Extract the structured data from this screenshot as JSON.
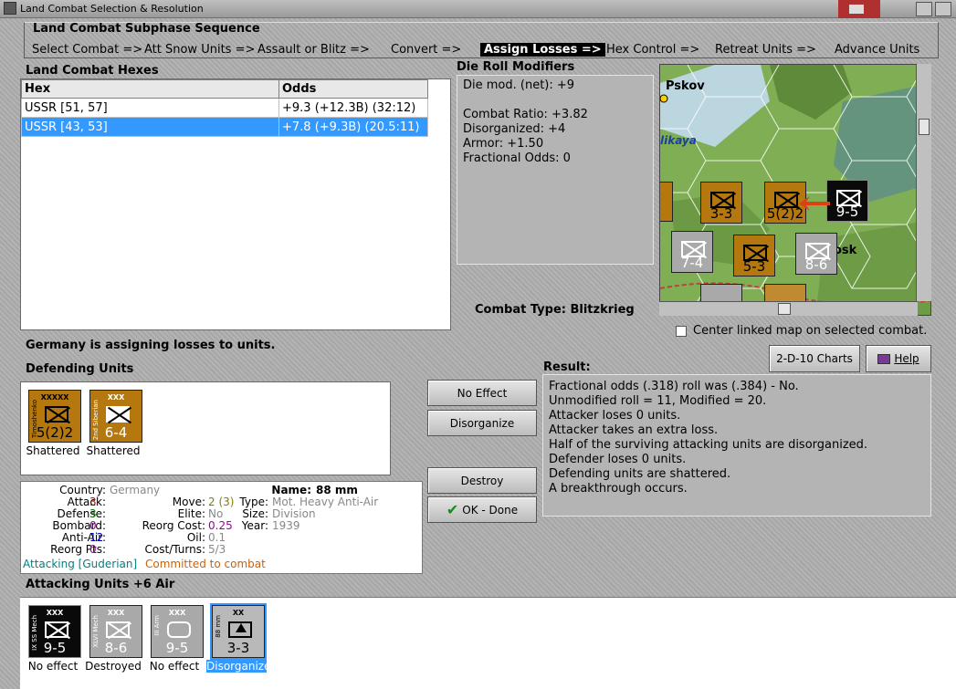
{
  "window": {
    "title": "Land Combat Selection & Resolution"
  },
  "sequence": {
    "title": "Land Combat Subphase Sequence",
    "steps": [
      "Select Combat =>",
      "Att Snow Units =>",
      "Assault or Blitz =>",
      "Convert =>",
      "Assign Losses =>",
      "Hex Control =>",
      "Retreat Units =>",
      "Advance Units"
    ],
    "active_step": "Assign Losses =>"
  },
  "hexes": {
    "title": "Land Combat Hexes",
    "columns": [
      "Hex",
      "Odds"
    ],
    "rows": [
      {
        "hex": "USSR [51, 57]",
        "odds": "+9.3 (+12.3B) (32:12)"
      },
      {
        "hex": "USSR [43, 53]",
        "odds": "+7.8 (+9.3B) (20.5:11)"
      }
    ],
    "selected_row": "USSR [43, 53]"
  },
  "modifiers": {
    "title": "Die Roll Modifiers",
    "net": "Die mod. (net): +9",
    "lines": [
      "Combat Ratio: +3.82",
      "Disorganized: +4",
      "Armor: +1.50",
      "Fractional Odds: 0"
    ]
  },
  "combat_type": "Combat Type:  Blitzkrieg",
  "map": {
    "labels": [
      "Pskov",
      "likaya",
      "osk"
    ],
    "counters": [
      "3-3",
      "5(2)2",
      "9-5",
      "7-4",
      "5-3",
      "8-6"
    ],
    "center_label": "Center linked map on selected combat.",
    "center_checked": false
  },
  "status": "Germany is assigning losses to units.",
  "buttons": {
    "charts": "2-D-10 Charts",
    "help": "Help",
    "no_effect": "No Effect",
    "disorganize": "Disorganize",
    "destroy": "Destroy",
    "ok_done": "OK - Done"
  },
  "defending": {
    "title": "Defending Units",
    "units": [
      {
        "name": "Timoshenko",
        "size": "XXXXX",
        "strength": "5(2)2",
        "status": "Shattered"
      },
      {
        "name": "2nd Siberian",
        "size": "XXX",
        "strength": "6-4",
        "status": "Shattered"
      }
    ]
  },
  "result": {
    "title": "Result:",
    "lines": [
      "Fractional odds (.318) roll was (.384)  - No.",
      "Unmodified roll = 11, Modified = 20.",
      "Attacker loses 0 units.",
      "Attacker takes an extra loss.",
      "Half of the surviving attacking units are disorganized.",
      "Defender loses 0 units.",
      "Defending units are shattered.",
      "A breakthrough occurs."
    ]
  },
  "info": {
    "labels": {
      "country": "Country:",
      "attack": "Attack:",
      "defense": "Defense:",
      "bombard": "Bombard:",
      "anti_air": "Anti-Air:",
      "reorg_pts": "Reorg Pts:",
      "move": "Move:",
      "elite": "Elite:",
      "reorg_cost": "Reorg Cost:",
      "oil": "Oil:",
      "cost_turns": "Cost/Turns:",
      "name": "Name:",
      "type": "Type:",
      "size": "Size:",
      "year": "Year:"
    },
    "values": {
      "country": "Germany",
      "attack": "3",
      "defense": "3",
      "bombard": "0",
      "anti_air": "12",
      "reorg_pts": "0",
      "move": "2 (3)",
      "elite": "No",
      "reorg_cost": "0.25",
      "oil": "0.1",
      "cost_turns": "5/3",
      "name": "88 mm",
      "type": "Mot. Heavy Anti-Air",
      "size": "Division",
      "year": "1939"
    },
    "attacking": "Attacking [Guderian]",
    "committed": "Committed to combat"
  },
  "attacking": {
    "title": "Attacking Units +6 Air",
    "units": [
      {
        "name": "IX SS Mech",
        "size": "XXX",
        "strength": "9-5",
        "status": "No effect"
      },
      {
        "name": "XLVI Mech",
        "size": "XXX",
        "strength": "8-6",
        "status": "Destroyed"
      },
      {
        "name": "III Arm",
        "size": "XXX",
        "strength": "9-5",
        "status": "No effect"
      },
      {
        "name": "88 mm",
        "size": "XX",
        "strength": "3-3",
        "status": "Disorganized"
      }
    ],
    "selected_unit": "88 mm"
  },
  "colors": {
    "selection": "#3399ff",
    "active_step_bg": "#000000",
    "german_counter": "#0a0a0a",
    "soviet_counter": "#b5780e"
  }
}
